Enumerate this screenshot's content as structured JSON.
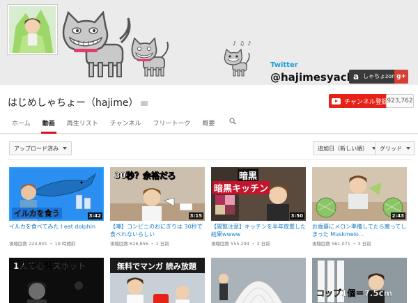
{
  "banner": {
    "notes": "♪ ♫ ♪",
    "twitter_label": "Twitter",
    "twitter_handle": "@hajimesyacho",
    "amazon_glyph": "a",
    "amazon_text": "しゃちょzon",
    "gplus_glyph": "g+"
  },
  "channel": {
    "title": "はじめしゃちょー（hajime）",
    "subscribe_label": "チャンネル登録",
    "subscriber_count": "923,762"
  },
  "tabs": [
    {
      "label": "ホーム",
      "active": false
    },
    {
      "label": "動画",
      "active": true
    },
    {
      "label": "再生リスト",
      "active": false
    },
    {
      "label": "チャンネル",
      "active": false
    },
    {
      "label": "フリートーク",
      "active": false
    },
    {
      "label": "概要",
      "active": false
    }
  ],
  "toolbar": {
    "upload_filter": "アップロード済み",
    "sort": "追加日（新しい順）",
    "view": "グリッド"
  },
  "videos": [
    {
      "overlay": "イルカを食う",
      "duration": "3:42",
      "title": "イルカを食べてみた I eat dolphin",
      "meta": "視聴回数 224,801 ・ 19 時間前"
    },
    {
      "overlay": "30秒？余裕だろ",
      "duration": "3:15",
      "title": "【噂】コンビニのおにぎりは 30秒で食べれないらしい",
      "meta": "視聴回数 626,856 ・ 1 日前"
    },
    {
      "overlay": "暗黒キッチン",
      "duration": "3:50",
      "title": "【閲覧注意】キッチンを半年放置した結果wwww",
      "meta": "視聴回数 555,294 ・ 2 日前"
    },
    {
      "overlay": "",
      "duration": "2:43",
      "title": "お歳暮にメロン準備してたら腐ってしまった Muskmelo...",
      "meta": "視聴回数 561,071 ・ 3 日前"
    },
    {
      "overlay": "1人で心霊スポット",
      "duration": "",
      "title": "",
      "meta": ""
    },
    {
      "overlay": "無料でマンガ 読み放題",
      "duration": "",
      "title": "",
      "meta": ""
    },
    {
      "overlay": "",
      "duration": "",
      "title": "",
      "meta": ""
    },
    {
      "overlay": "コップ1個＝7.5cm",
      "duration": "",
      "title": "",
      "meta": ""
    }
  ],
  "colors": {
    "subscribe_red": "#e62117",
    "link_blue": "#167ac6",
    "tab_underline": "#cc181e",
    "twitter_blue": "#1e9ed8"
  }
}
